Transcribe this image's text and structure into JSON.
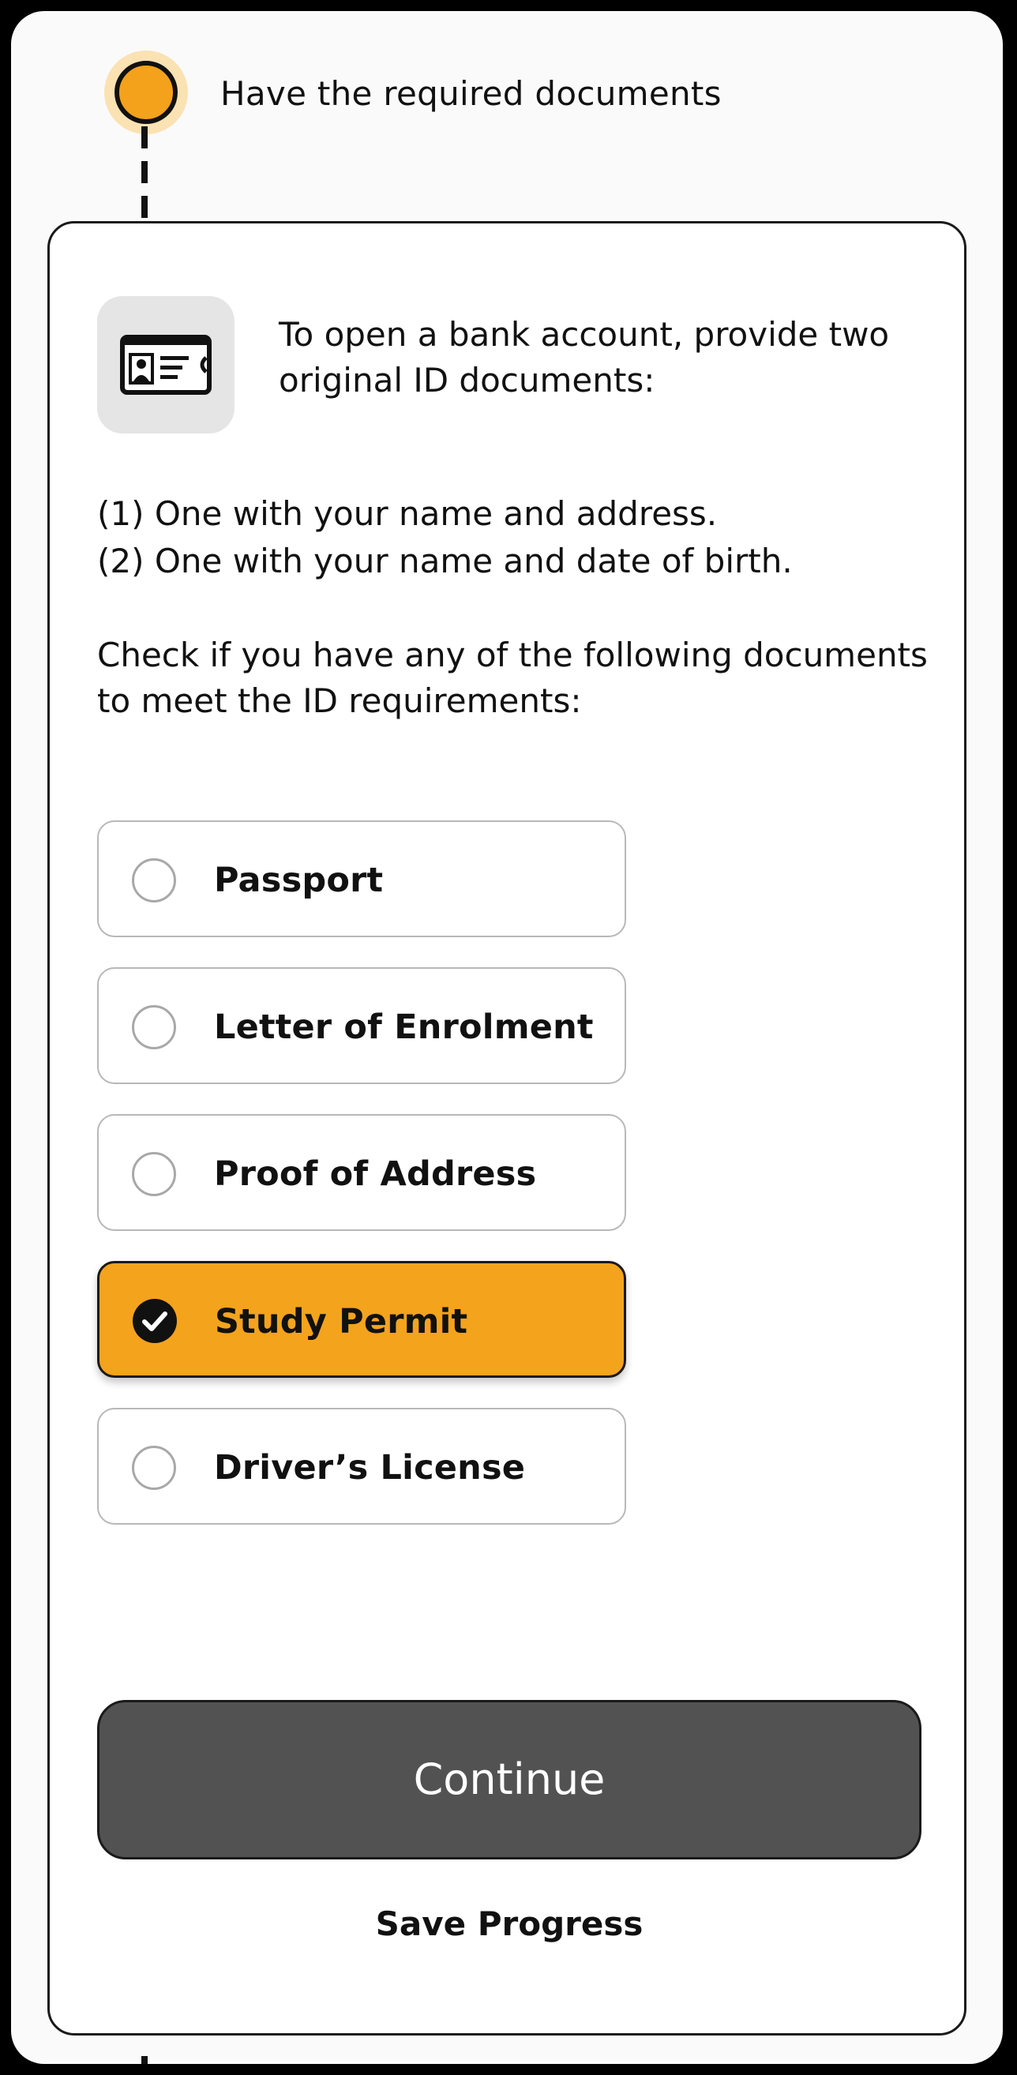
{
  "step": {
    "title": "Have the required documents"
  },
  "card": {
    "icon": "id-card-icon",
    "intro": "To open a bank account, provide two original ID documents:",
    "requirement_1": "(1) One with your name and address.",
    "requirement_2": "(2) One with your name and date of birth.",
    "check_prompt": "Check if you have any of the following documents to meet the ID requirements:",
    "options": [
      {
        "label": "Passport",
        "selected": false
      },
      {
        "label": "Letter of Enrolment",
        "selected": false
      },
      {
        "label": "Proof of Address",
        "selected": false
      },
      {
        "label": "Study Permit",
        "selected": true
      },
      {
        "label": "Driver’s License",
        "selected": false
      }
    ],
    "continue_label": "Continue",
    "save_label": "Save Progress"
  },
  "colors": {
    "accent": "#f4a31c",
    "button": "#525252"
  }
}
